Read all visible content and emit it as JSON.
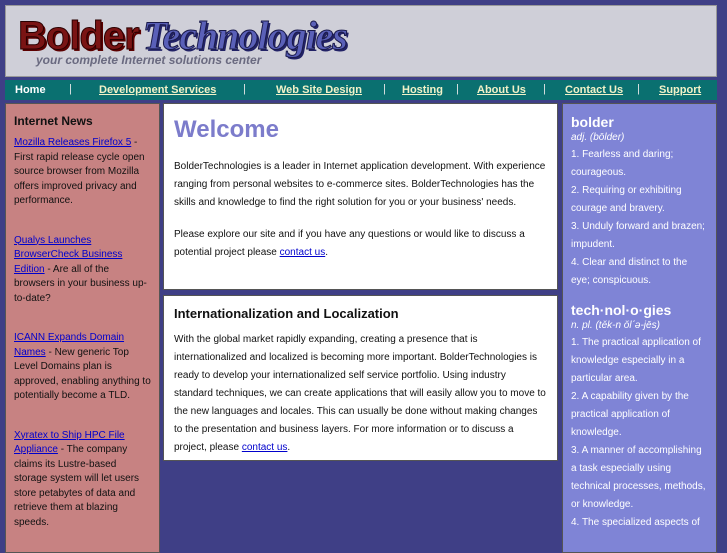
{
  "header": {
    "logo_word1": "Bolder",
    "logo_word2": "Technologies",
    "tagline": "your complete Internet solutions center"
  },
  "nav": [
    {
      "label": "Home"
    },
    {
      "label": "Development Services"
    },
    {
      "label": "Web Site Design"
    },
    {
      "label": "Hosting"
    },
    {
      "label": "About Us"
    },
    {
      "label": "Contact Us"
    },
    {
      "label": "Support"
    }
  ],
  "nav_separator": "|",
  "news": {
    "title": "Internet News",
    "items": [
      {
        "link": "Mozilla Releases Firefox 5",
        "text": " - First rapid release cycle open source browser from Mozilla offers improved privacy and performance."
      },
      {
        "link": "Qualys Launches BrowserCheck Business Edition",
        "text": " - Are all of the browsers in your business up-to-date?"
      },
      {
        "link": "ICANN Expands Domain Names",
        "text": " - New generic Top Level Domains plan is approved, enabling anything to potentially become a TLD."
      },
      {
        "link": "Xyratex to Ship HPC File Appliance",
        "text": " - The company claims its Lustre-based storage system will let users store petabytes of data and retrieve them at blazing speeds."
      }
    ]
  },
  "welcome": {
    "title": "Welcome",
    "p1": "BolderTechnologies is a leader in Internet application development. With experience ranging from personal websites to e-commerce sites. BolderTechnologies has the skills and knowledge to find the right solution for you or your business' needs.",
    "p2_pre": "Please explore our site and if you have any questions or would like to discuss a potential project please ",
    "p2_link": "contact us",
    "p2_post": "."
  },
  "intl": {
    "title": "Internationalization and Localization",
    "p_pre": "With the global market rapidly expanding, creating a presence that is internationalized and localized is becoming more important. BolderTechnologies is ready to develop your internationalized self service portfolio. Using industry standard techniques, we can create applications that will easily allow you to move to the new languages and locales. This can usually be done without making changes to the presentation and business layers. For more information or to discuss a project, please ",
    "p_link": "contact us",
    "p_post": "."
  },
  "dictionary": {
    "word1": "bolder",
    "pos1": "adj. (bōlder)",
    "defs1": [
      "1. Fearless and daring; courageous.",
      "2. Requiring or exhibiting courage and bravery.",
      "3. Unduly forward and brazen; impudent.",
      "4. Clear and distinct to the eye; conspicuous."
    ],
    "word2": "tech·nol·o·gies",
    "pos2": "n. pl. (tĕk-n ŏlˊə-jēs)",
    "defs2": [
      "1. The practical application of knowledge especially in a particular area.",
      "2. A capability given by the practical application of knowledge.",
      "3. A manner of accomplishing a task especially using technical processes, methods, or knowledge.",
      "4. The specialized aspects of"
    ]
  }
}
